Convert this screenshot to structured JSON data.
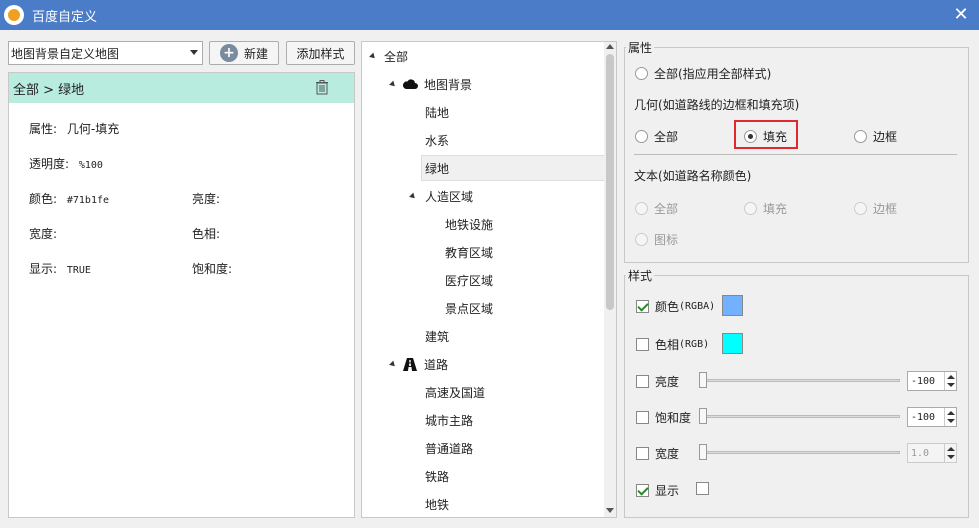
{
  "window": {
    "title": "百度自定义",
    "close": "✕"
  },
  "left": {
    "map_select": "地图背景自定义地图",
    "new_button": "新建",
    "add_style_button": "添加样式",
    "breadcrumb": "全部 > 绿地",
    "props": {
      "attr_label": "属性:",
      "attr_value": "几何-填充",
      "opacity_label": "透明度:",
      "opacity_value": "%100",
      "color_label": "颜色:",
      "color_value": "#71b1fe",
      "brightness_label": "亮度:",
      "width_label": "宽度:",
      "hue_label": "色相:",
      "display_label": "显示:",
      "display_value": "TRUE",
      "saturation_label": "饱和度:"
    }
  },
  "tree": {
    "items": [
      {
        "label": "全部"
      },
      {
        "label": "地图背景"
      },
      {
        "label": "陆地"
      },
      {
        "label": "水系"
      },
      {
        "label": "绿地"
      },
      {
        "label": "人造区域"
      },
      {
        "label": "地铁设施"
      },
      {
        "label": "教育区域"
      },
      {
        "label": "医疗区域"
      },
      {
        "label": "景点区域"
      },
      {
        "label": "建筑"
      },
      {
        "label": "道路"
      },
      {
        "label": "高速及国道"
      },
      {
        "label": "城市主路"
      },
      {
        "label": "普通道路"
      },
      {
        "label": "铁路"
      },
      {
        "label": "地铁"
      }
    ]
  },
  "attributes": {
    "group_label": "属性",
    "all_option": "全部(指应用全部样式)",
    "geometry_label": "几何(如道路线的边框和填充项)",
    "geo_all": "全部",
    "geo_fill": "填充",
    "geo_border": "边框",
    "text_label": "文本(如道路名称颜色)",
    "text_all": "全部",
    "text_fill": "填充",
    "text_border": "边框",
    "text_icon": "图标"
  },
  "style": {
    "group_label": "样式",
    "color_label": "颜色",
    "color_suffix": "(RGBA)",
    "color_swatch": "#71b1fe",
    "hue_label": "色相",
    "hue_suffix": "(RGB)",
    "hue_swatch": "#00ffff",
    "brightness_label": "亮度",
    "brightness_value": "-100",
    "saturation_label": "饱和度",
    "saturation_value": "-100",
    "width_label": "宽度",
    "width_value": "1.0",
    "display_label": "显示"
  },
  "colors": {
    "titlebar": "#4a7cc7",
    "breadcrumb_bg": "#b8ecde",
    "highlight": "#e0282e"
  }
}
